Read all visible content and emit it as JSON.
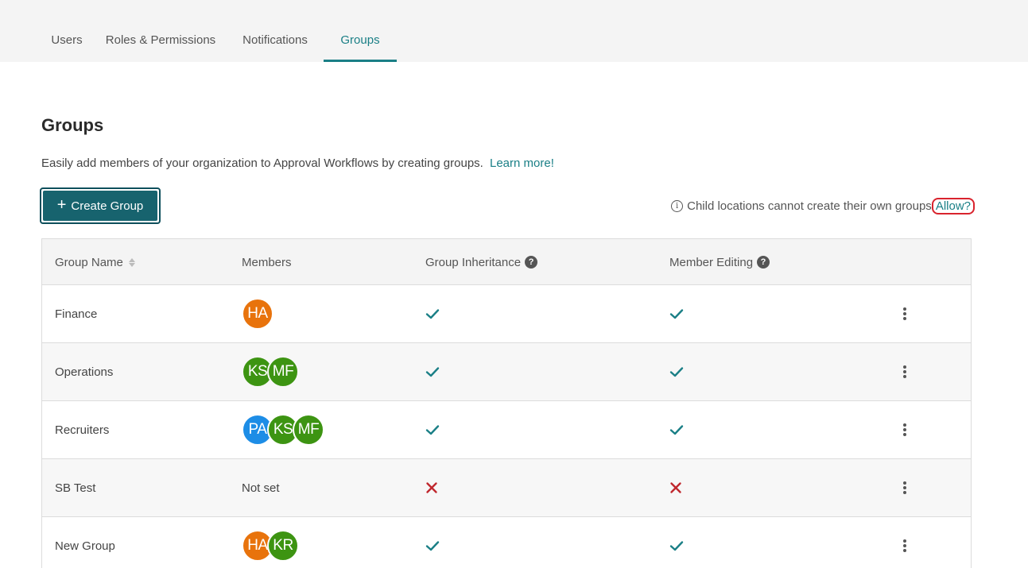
{
  "tabs": [
    {
      "label": "Users",
      "active": false
    },
    {
      "label": "Roles & Permissions",
      "active": false
    },
    {
      "label": "Notifications",
      "active": false
    },
    {
      "label": "Groups",
      "active": true
    }
  ],
  "page": {
    "title": "Groups",
    "description": "Easily add members of your organization to Approval Workflows by creating groups.",
    "learn_more": "Learn more!",
    "create_button": "Create Group",
    "notice_text": "Child locations cannot create their own groups",
    "allow_link": "Allow?"
  },
  "table": {
    "headers": {
      "name": "Group Name",
      "members": "Members",
      "inheritance": "Group Inheritance",
      "editing": "Member Editing"
    },
    "rows": [
      {
        "name": "Finance",
        "members": [
          {
            "initials": "HA",
            "color": "#e8730c"
          }
        ],
        "members_text": "",
        "inheritance": true,
        "editing": true
      },
      {
        "name": "Operations",
        "members": [
          {
            "initials": "KS",
            "color": "#3d9412"
          },
          {
            "initials": "MF",
            "color": "#3d9412"
          }
        ],
        "members_text": "",
        "inheritance": true,
        "editing": true
      },
      {
        "name": "Recruiters",
        "members": [
          {
            "initials": "PA",
            "color": "#1d8de6"
          },
          {
            "initials": "KS",
            "color": "#3d9412"
          },
          {
            "initials": "MF",
            "color": "#3d9412"
          }
        ],
        "members_text": "",
        "inheritance": true,
        "editing": true
      },
      {
        "name": "SB Test",
        "members": [],
        "members_text": "Not set",
        "inheritance": false,
        "editing": false
      },
      {
        "name": "New Group",
        "members": [
          {
            "initials": "HA",
            "color": "#e8730c"
          },
          {
            "initials": "KR",
            "color": "#3d9412"
          }
        ],
        "members_text": "",
        "inheritance": true,
        "editing": true
      }
    ]
  },
  "colors": {
    "accent": "#1a7f86",
    "button_bg": "#17636e",
    "check": "#1a7f86",
    "cross": "#c0282e",
    "highlight_ring": "#d9232d"
  }
}
